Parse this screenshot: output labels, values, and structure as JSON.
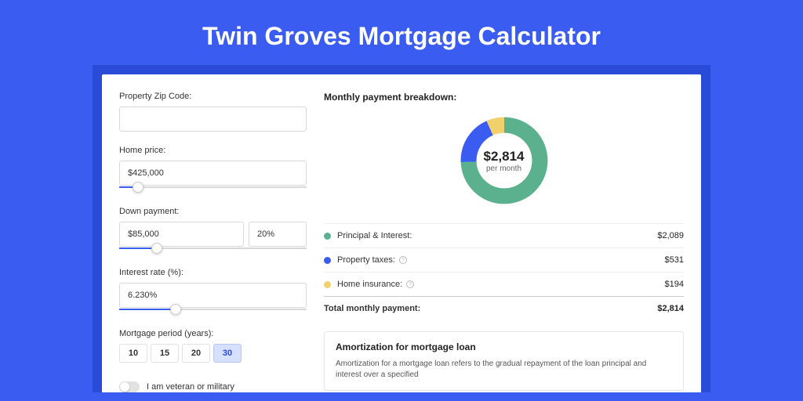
{
  "title": "Twin Groves Mortgage Calculator",
  "form": {
    "zip_label": "Property Zip Code:",
    "zip_value": "",
    "price_label": "Home price:",
    "price_value": "$425,000",
    "price_slider_pct": 10,
    "down_label": "Down payment:",
    "down_value": "$85,000",
    "down_pct": "20%",
    "down_slider_pct": 20,
    "rate_label": "Interest rate (%):",
    "rate_value": "6.230%",
    "rate_slider_pct": 30,
    "period_label": "Mortgage period (years):",
    "periods": [
      "10",
      "15",
      "20",
      "30"
    ],
    "period_active_index": 3,
    "veteran_label": "I am veteran or military"
  },
  "breakdown": {
    "title": "Monthly payment breakdown:",
    "center_value": "$2,814",
    "center_sub": "per month",
    "items": [
      {
        "label": "Principal & Interest:",
        "value": "$2,089",
        "color": "#5bb08e",
        "info": false
      },
      {
        "label": "Property taxes:",
        "value": "$531",
        "color": "#3a5cf0",
        "info": true
      },
      {
        "label": "Home insurance:",
        "value": "$194",
        "color": "#f2d06b",
        "info": true
      }
    ],
    "total_label": "Total monthly payment:",
    "total_value": "$2,814"
  },
  "chart_data": {
    "type": "pie",
    "title": "Monthly payment breakdown",
    "categories": [
      "Principal & Interest",
      "Property taxes",
      "Home insurance"
    ],
    "values": [
      2089,
      531,
      194
    ],
    "colors": [
      "#5bb08e",
      "#3a5cf0",
      "#f2d06b"
    ],
    "total": 2814
  },
  "amortization": {
    "title": "Amortization for mortgage loan",
    "text": "Amortization for a mortgage loan refers to the gradual repayment of the loan principal and interest over a specified"
  }
}
